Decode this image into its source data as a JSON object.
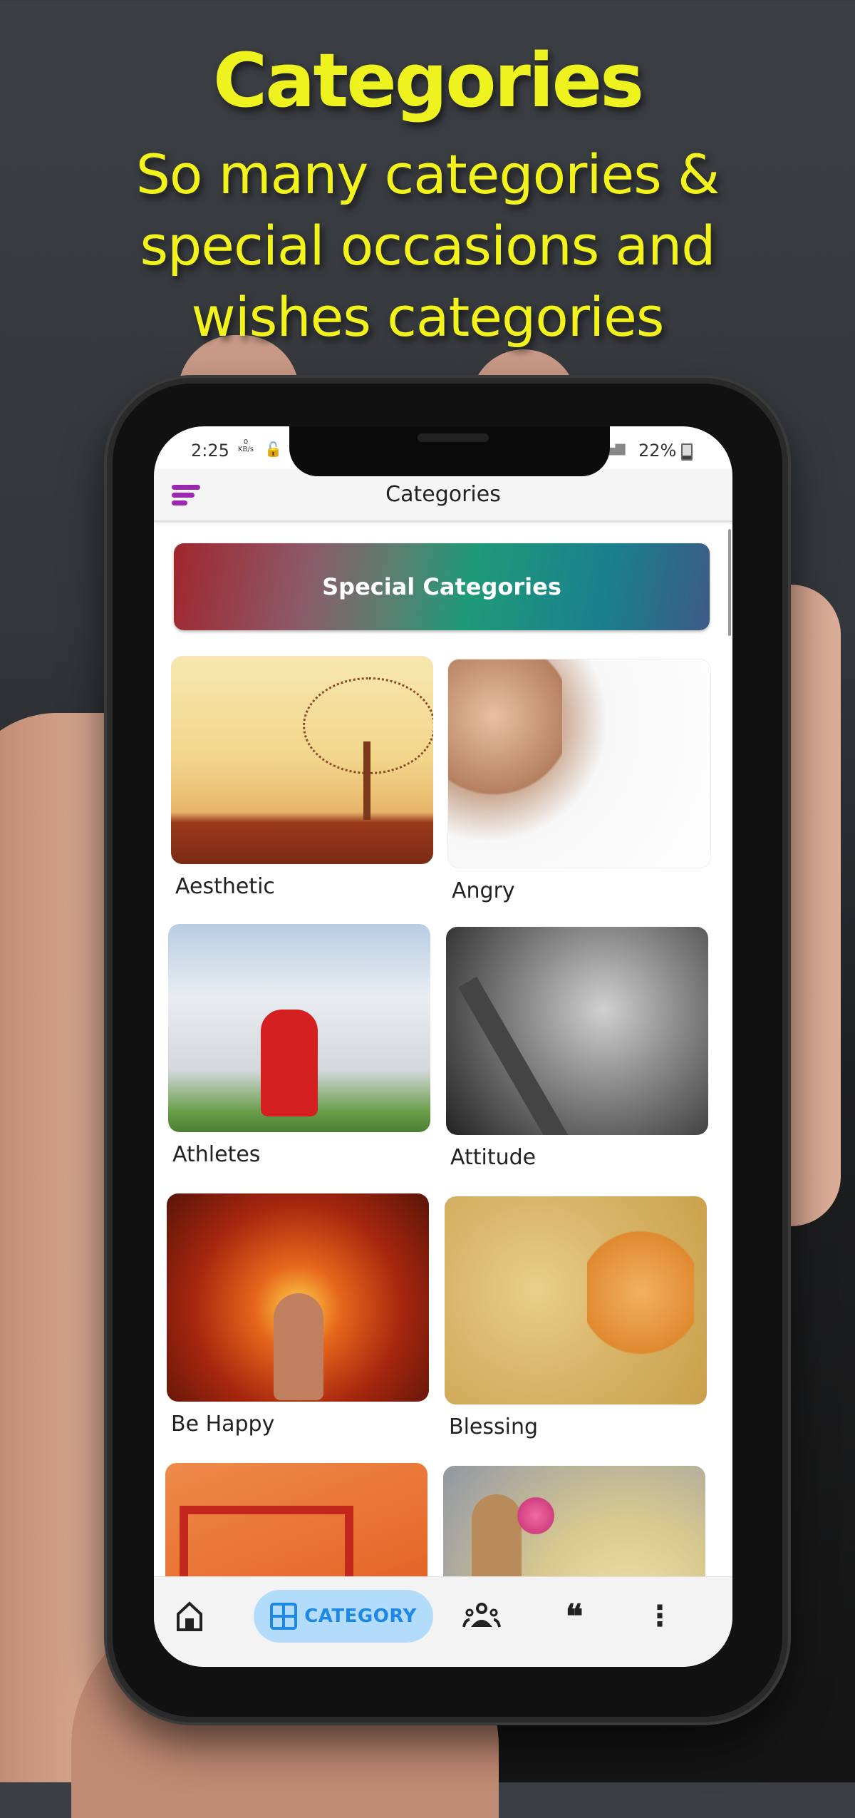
{
  "promo": {
    "title": "Categories",
    "subtitle_lines": [
      "So many categories &",
      "special occasions  and",
      "wishes categories"
    ],
    "accent_color": "#eef21e"
  },
  "status_bar": {
    "time": "2:25",
    "data_rate_value": "0",
    "data_rate_unit": "KB/s",
    "battery_percent": "22%",
    "icons": [
      "lock-icon",
      "signal-icon",
      "battery-icon"
    ]
  },
  "app_bar": {
    "title": "Categories",
    "menu_icon": "menu-icon",
    "menu_color": "#9c27b0"
  },
  "special_banner": {
    "label": "Special Categories"
  },
  "categories": [
    {
      "label": "Aesthetic"
    },
    {
      "label": "Angry"
    },
    {
      "label": "Athletes"
    },
    {
      "label": "Attitude"
    },
    {
      "label": "Be Happy"
    },
    {
      "label": "Blessing"
    },
    {
      "label": ""
    },
    {
      "label": ""
    }
  ],
  "bottom_nav": {
    "items": [
      {
        "icon": "home-icon",
        "label": ""
      },
      {
        "icon": "grid-icon",
        "label": "CATEGORY",
        "active": true
      },
      {
        "icon": "people-icon",
        "label": ""
      },
      {
        "icon": "quote-icon",
        "label": ""
      },
      {
        "icon": "more-vert-icon",
        "label": ""
      }
    ],
    "active_color": "#1e88e5",
    "active_bg": "#b3dbfa"
  }
}
